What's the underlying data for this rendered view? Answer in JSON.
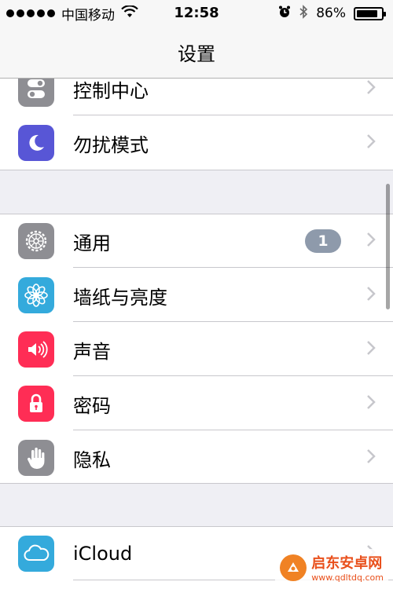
{
  "status_bar": {
    "carrier": "中国移动",
    "time": "12:58",
    "battery_percent": "86%",
    "battery_level": 0.86,
    "icons": [
      "signal-dots",
      "wifi-icon",
      "alarm-icon",
      "bluetooth-icon",
      "battery-icon"
    ]
  },
  "nav": {
    "title": "设置"
  },
  "groups": {
    "first": {
      "items": [
        {
          "label": "控制中心",
          "icon": "control-center-icon",
          "color": "#8e8e93"
        },
        {
          "label": "勿扰模式",
          "icon": "moon-icon",
          "color": "#5856d6"
        }
      ]
    },
    "second": {
      "items": [
        {
          "label": "通用",
          "icon": "gear-icon",
          "color": "#8e8e93",
          "badge": "1"
        },
        {
          "label": "墙纸与亮度",
          "icon": "flower-icon",
          "color": "#34aadc"
        },
        {
          "label": "声音",
          "icon": "speaker-icon",
          "color": "#ff2d55"
        },
        {
          "label": "密码",
          "icon": "lock-icon",
          "color": "#ff2d55"
        },
        {
          "label": "隐私",
          "icon": "hand-icon",
          "color": "#8e8e93"
        }
      ]
    },
    "third": {
      "items": [
        {
          "label": "iCloud",
          "icon": "cloud-icon",
          "color": "#34aadc"
        }
      ]
    }
  },
  "watermark": {
    "name": "启东安卓网",
    "url": "www.qdltdq.com"
  }
}
